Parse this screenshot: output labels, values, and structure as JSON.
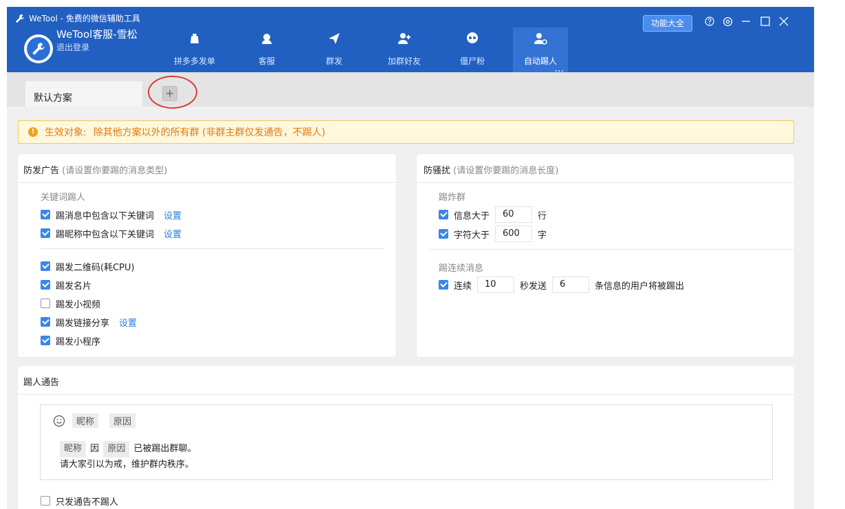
{
  "window": {
    "title": "WeTool - 免费的微信辅助工具"
  },
  "account": {
    "name": "WeTool客服-雪松",
    "logout": "退出登录"
  },
  "nav": [
    {
      "label": "拼多多发单",
      "icon": "bag-icon"
    },
    {
      "label": "客服",
      "icon": "headset-icon"
    },
    {
      "label": "群发",
      "icon": "send-icon"
    },
    {
      "label": "加群好友",
      "icon": "add-friend-icon"
    },
    {
      "label": "僵尸粉",
      "icon": "skull-icon"
    },
    {
      "label": "自动踢人",
      "icon": "kick-user-icon",
      "more": "..."
    }
  ],
  "toolbar": {
    "feature_label": "功能大全"
  },
  "tabs": {
    "default": "默认方案",
    "add": "+"
  },
  "notice": {
    "label": "生效对象:",
    "text": "除其他方案以外的所有群 (非群主群仅发通告，不踢人)"
  },
  "ads": {
    "title": "防发广告",
    "hint": "(请设置你要踢的消息类型)",
    "keyword_section": "关键词踢人",
    "items": [
      {
        "label": "踢消息中包含以下关键词",
        "link": "设置",
        "checked": true
      },
      {
        "label": "踢昵称中包含以下关键词",
        "link": "设置",
        "checked": true
      },
      {
        "label": "踢发二维码(耗CPU)",
        "checked": true
      },
      {
        "label": "踢发名片",
        "checked": true
      },
      {
        "label": "踢发小视频",
        "checked": false
      },
      {
        "label": "踢发链接分享",
        "link": "设置",
        "checked": true
      },
      {
        "label": "踢发小程序",
        "checked": true
      }
    ]
  },
  "harass": {
    "title": "防骚扰",
    "hint": "(请设置你要踢的消息长度)",
    "flood_section": "踢炸群",
    "lines": {
      "label": "信息大于",
      "value": "60",
      "unit": "行",
      "checked": true
    },
    "chars": {
      "label": "字符大于",
      "value": "600",
      "unit": "字",
      "checked": true
    },
    "cont_section": "踢连续消息",
    "continuous": {
      "label1": "连续",
      "seconds": "10",
      "label2": "秒发送",
      "count": "6",
      "label3": "条信息的用户将被踢出",
      "checked": true
    }
  },
  "kick_notice": {
    "title": "踢人通告",
    "chips": [
      "昵称",
      "原因"
    ],
    "body_chip1": "昵称",
    "body_mid": "因",
    "body_chip2": "原因",
    "body_tail": "已被踢出群聊。",
    "body_line2": "请大家引以为戒，维护群内秩序。",
    "only_notice": {
      "label": "只发通告不踢人",
      "checked": false
    }
  }
}
